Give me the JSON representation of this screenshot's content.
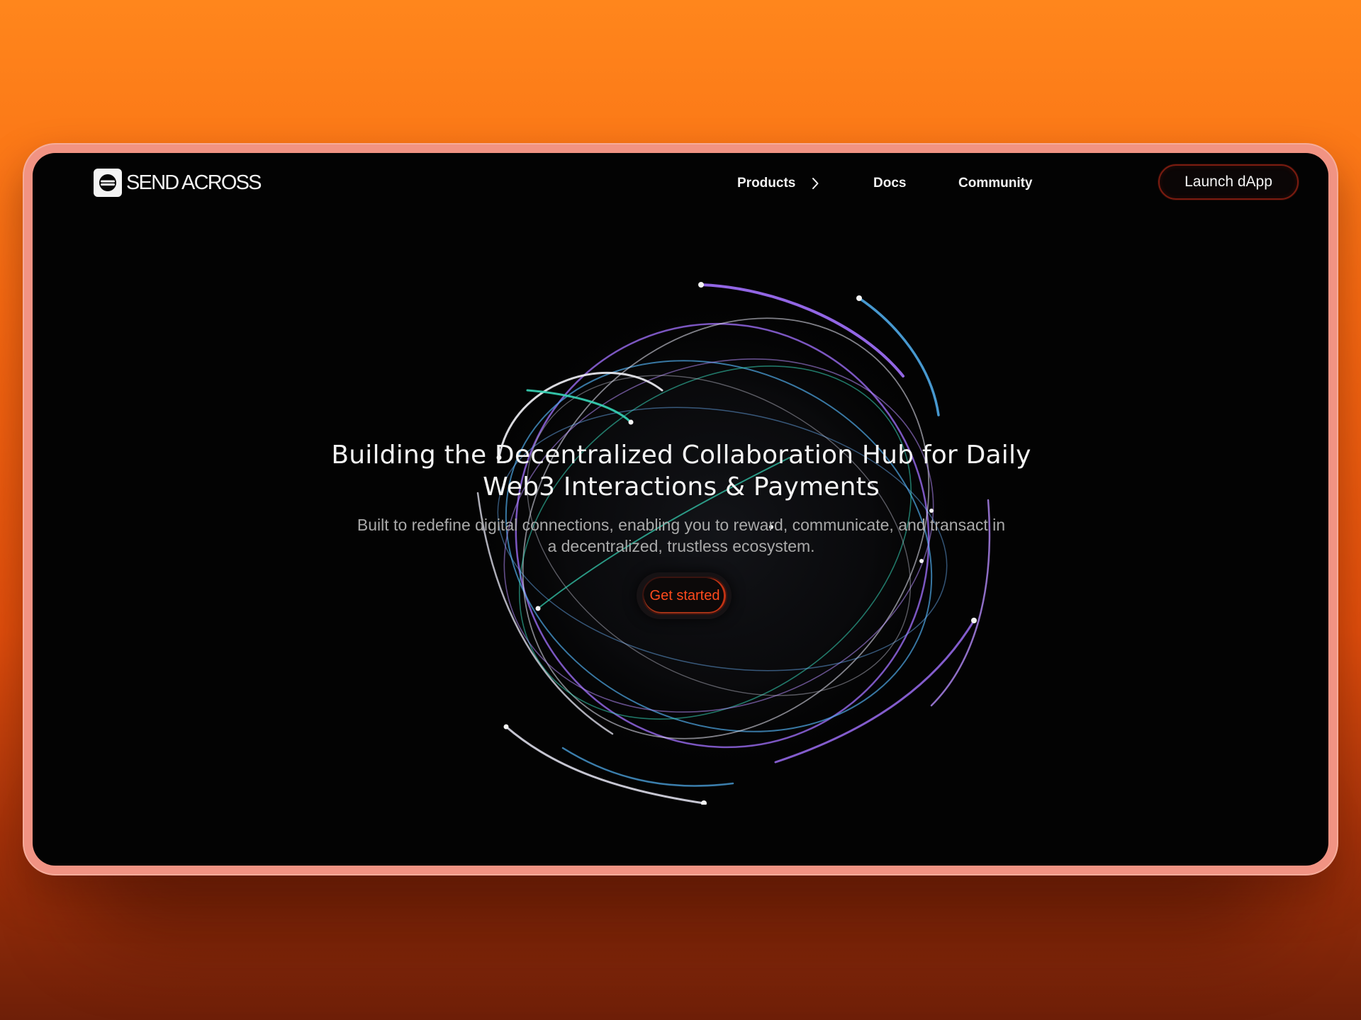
{
  "brand": {
    "name": "SEND ACROSS"
  },
  "nav": {
    "products": "Products",
    "docs": "Docs",
    "community": "Community"
  },
  "launch_button": "Launch dApp",
  "hero": {
    "headline_line1": "Building the Decentralized Collaboration Hub for Daily",
    "headline_line2": "Web3 Interactions & Payments",
    "sub_line1": "Built to redefine digital connections, enabling you to reward, communicate, and transact in",
    "sub_line2": "a decentralized, trustless ecosystem.",
    "cta": "Get started"
  },
  "colors": {
    "background_top": "#ff861c",
    "background_bottom": "#6e1f08",
    "frame": "#f19383",
    "screen": "#030303",
    "cta_text": "#ff4a1c",
    "orb_lines": [
      "#9a6cf0",
      "#4fa8e6",
      "#37d6b8",
      "#e8e8f6"
    ]
  },
  "icons": {
    "logo": "send-across-logo-icon",
    "products_chevron": "chevron-right-icon"
  }
}
